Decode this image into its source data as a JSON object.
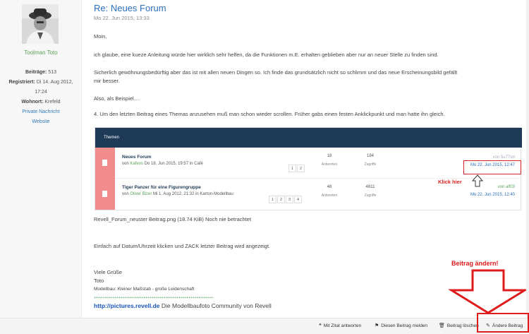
{
  "author": {
    "name": "Toolman Toto",
    "posts_label": "Beiträge:",
    "posts": "513",
    "registered_label": "Registriert:",
    "registered_line1": "Di 14. Aug 2012,",
    "registered_line2": "17:24",
    "location_label": "Wohnort:",
    "location": "Krefeld",
    "private_message": "Private Nachricht",
    "website": "Website"
  },
  "post": {
    "title": "Re: Neues Forum",
    "date": "Mo 22. Jun 2015, 13:33",
    "greeting": "Moin,",
    "para1": "ich glaube, eine kueze Anleitung würde hier wirklich sehr helfen, da die Funktionen m.E. erhalten geblieben aber nur an neuer Stelle zu finden sind.",
    "para2_line1": "Sicherlich gewöhnungsbedürftig aber das ist mit allen neuen Dingen so. Ich finde das grundsätzlich nicht so schlimm und das neue Erscheinungsbild gefällt",
    "para2_line2": "mir besser.",
    "para3": "Also, als Beispiel....",
    "para4": "4. Um den letzten Beitrag eines Themas anzusehen muß man schon wieder scrollen. Früher gabs einen festen Anklickpunkt und man hatte ihn gleich.",
    "attachment": "Revell_Forum_neuster Beitrag.png (18.74 KiB) Noch nie betrachtet",
    "para5": "Einfach auf Datum/Uhrzeit klicken und ZACK letzter Beitrag wird angezeigt.",
    "closing1": "Viele Grüße",
    "closing2": "Toto",
    "sig_line1": "Modellbau: Kleiner Maßstab - große Leidenschaft",
    "sig_plus": "++++++++++++++++++++++++++++++++++++++++++++++++++++++++++",
    "sig_link": "http://pictures.revell.de",
    "sig_link_suffix": "Die Modellbaufoto Community von Revell"
  },
  "screenshot": {
    "header": "Themen",
    "rows": [
      {
        "topic": "Neues Forum",
        "by_prefix": "von",
        "user": "Kafens",
        "by_suffix": "Do 18. Jun 2015, 19:57 in Café",
        "pages": [
          "1",
          "2"
        ],
        "answers": "18",
        "answers_label": "Antworten",
        "views": "184",
        "views_label": "Zugriffe",
        "last_top": "von 5u77on",
        "last_date": "Mo 22. Jun 2015, 12:47"
      },
      {
        "topic": "Tiger Panzer für eine Figurengruppe",
        "by_prefix": "von",
        "user": "Oliver Bizer",
        "by_suffix": "Mi 1. Aug 2012, 21:32 in Karton-Modellbau",
        "pages": [
          "1",
          "2",
          "3",
          "4"
        ],
        "answers": "46",
        "answers_label": "Antworten",
        "views": "4811",
        "views_label": "Zugriffe",
        "last_top": "von alf03",
        "last_date": "Mo 22. Jun 2015, 12:40"
      }
    ],
    "annotation": "Klick hier"
  },
  "annotation": {
    "beitrag_aendern": "Beitrag ändern!"
  },
  "footer": {
    "quote": "Mit Zitat antworten",
    "report": "Diesen Beitrag melden",
    "delete": "Beitrag löschen",
    "edit": "Ändere Beitrag"
  },
  "icons": {
    "quote": "quote-icon",
    "report": "flag-icon",
    "delete": "trash-icon",
    "edit": "pencil-icon"
  },
  "colors": {
    "link": "#2a6ebb",
    "user_green": "#5aa25a",
    "annotation_red": "#e01b1b",
    "screenshot_header": "#1e3a57",
    "topic_pink": "#f08c8c"
  }
}
